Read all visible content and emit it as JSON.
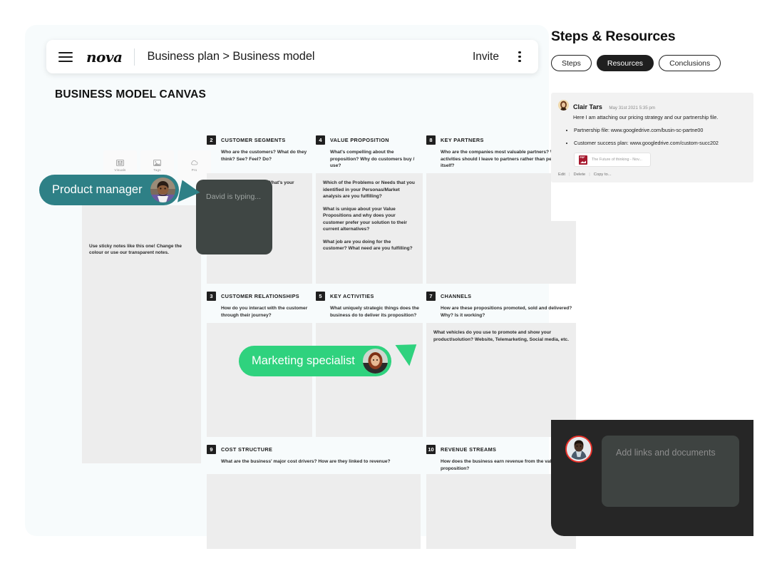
{
  "topbar": {
    "brand": "nova",
    "breadcrumb": "Business plan > Business model",
    "invite_label": "Invite"
  },
  "canvas": {
    "title": "BUSINESS MODEL CANVAS",
    "tools": [
      {
        "label": "Visuals",
        "icon": "image-grid-icon"
      },
      {
        "label": "Tags",
        "icon": "picture-icon"
      },
      {
        "label": "Pro",
        "icon": "cloud-icon"
      }
    ],
    "sticky_note": "Use sticky notes like this one! Change the colour or use our transparent notes.",
    "typing_indicator": "David is typing...",
    "sections": [
      {
        "num": "2",
        "name": "CUSTOMER SEGMENTS",
        "hint": "Who are the customers? What do they think? See? Feel? Do?",
        "body": [
          "Who is your customer? What's your market size?"
        ]
      },
      {
        "num": "4",
        "name": "VALUE PROPOSITION",
        "hint": "What's compelling about the proposition? Why do customers buy / use?",
        "body": [
          "Which of the Problems or Needs that you identified in your Personas/Market analysis are you fulfilling?",
          "What is unique about your Value Propositions and why does your customer prefer your solution to their current alternatives?",
          "What job are you doing for the customer? What need are you fulfilling?"
        ]
      },
      {
        "num": "8",
        "name": "KEY PARTNERS",
        "hint": "Who are the companies most valuable partners? What activities should I leave to partners rather than performing itself?",
        "body": []
      },
      {
        "num": "3",
        "name": "CUSTOMER RELATIONSHIPS",
        "hint": "How do you interact with the customer through their journey?",
        "body": []
      },
      {
        "num": "5",
        "name": "KEY ACTIVITIES",
        "hint": "What uniquely strategic things does the business do to deliver its proposition?",
        "body": []
      },
      {
        "num": "7",
        "name": "CHANNELS",
        "hint": "How are these propositions promoted, sold and delivered? Why? Is it working?",
        "body": [
          "What vehicles do you use to promote and show your product/solution? Website, Telemarketing, Social media, etc."
        ]
      },
      {
        "num": "9",
        "name": "COST STRUCTURE",
        "hint": "What are the business' major cost drivers? How are they linked to revenue?",
        "body": []
      },
      {
        "num": "10",
        "name": "REVENUE STREAMS",
        "hint": "How does the business earn revenue from the value proposition?",
        "body": []
      }
    ],
    "cursors": [
      {
        "label": "Product manager",
        "color": "#2e8086"
      },
      {
        "label": "Marketing specialist",
        "color": "#2fd27e"
      }
    ]
  },
  "right_panel": {
    "title": "Steps & Resources",
    "tabs": [
      {
        "label": "Steps",
        "active": false
      },
      {
        "label": "Resources",
        "active": true
      },
      {
        "label": "Conclusions",
        "active": false
      }
    ],
    "comment": {
      "author": "Clair Tars",
      "timestamp": "May 31st 2021 5:35 pm",
      "text": "Here I am attaching our pricing strategy and our partnership file.",
      "bullets": [
        "Partnership file: www.googledrive.com/busin-sc-partne00",
        "Customer success plan: www.googledrive.com/custom-succ202"
      ],
      "attachment": "The Future of thinking - Nov...",
      "actions": [
        "Edit",
        "Delete",
        "Copy to..."
      ]
    }
  },
  "composer": {
    "placeholder": "Add links and documents"
  }
}
